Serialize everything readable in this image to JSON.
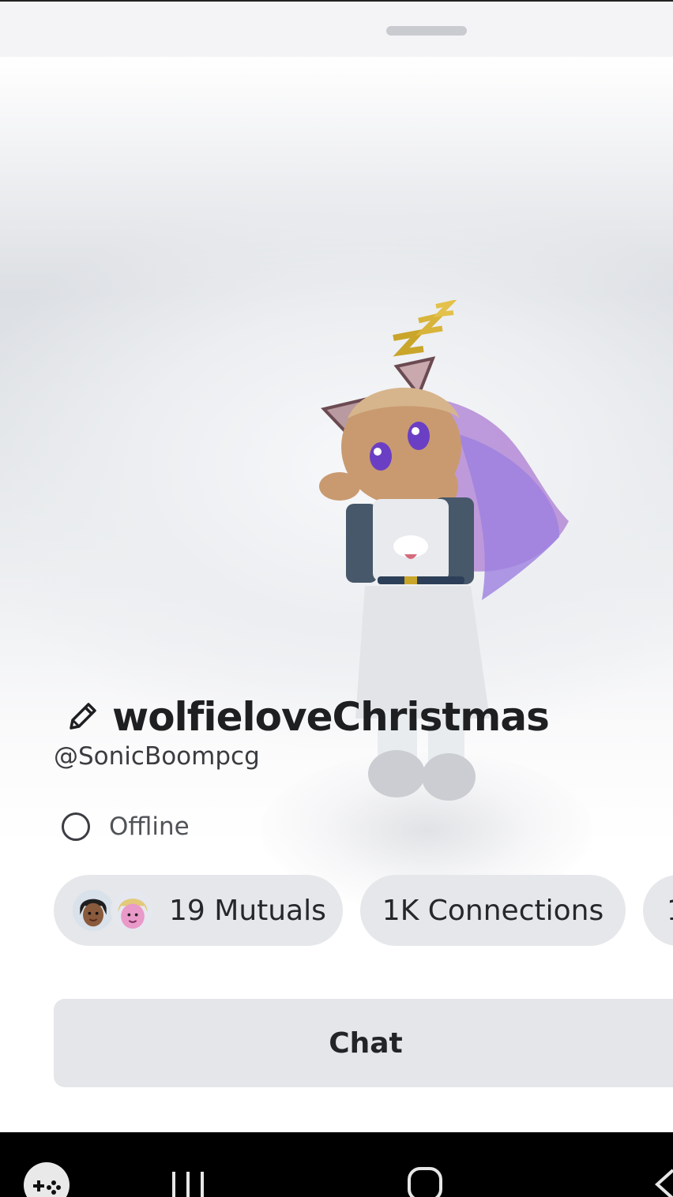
{
  "profile": {
    "display_name": "wolfieloveChristmas",
    "username": "@SonicBoompcg",
    "status": "Offline"
  },
  "stats": {
    "mutuals_label": "19 Mutuals",
    "connections_label": "1K Connections",
    "partial_label": "1"
  },
  "actions": {
    "chat_label": "Chat"
  },
  "icons": {
    "edit": "pencil-icon",
    "status": "offline-ring-icon",
    "nav_game": "gamepad-icon",
    "nav_recents": "recents-icon",
    "nav_home": "home-icon",
    "nav_back": "back-icon"
  },
  "colors": {
    "chip_bg": "#e6e7ea",
    "button_bg": "#e5e6e9",
    "text_primary": "#1e1f21",
    "nav_bg": "#000000"
  }
}
